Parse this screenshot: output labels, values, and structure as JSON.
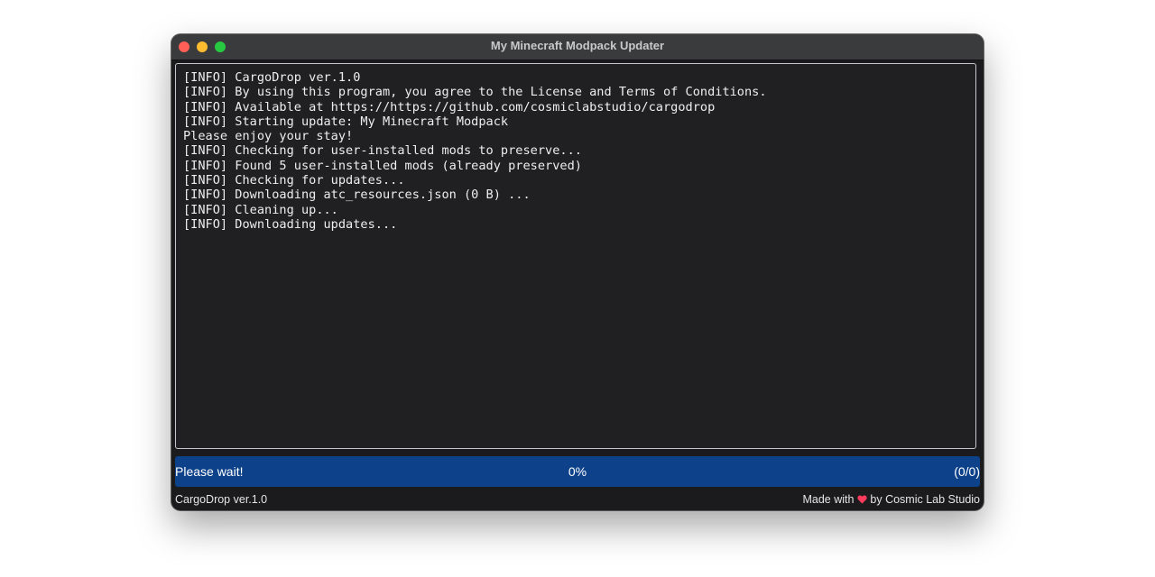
{
  "window": {
    "title": "My Minecraft Modpack Updater"
  },
  "traffic_lights": {
    "close_color": "#ff5f57",
    "minimize_color": "#febc2e",
    "zoom_color": "#28c840"
  },
  "log": {
    "lines": [
      "[INFO] CargoDrop ver.1.0",
      "[INFO] By using this program, you agree to the License and Terms of Conditions.",
      "[INFO] Available at https://https://github.com/cosmiclabstudio/cargodrop",
      "[INFO] Starting update: My Minecraft Modpack",
      "Please enjoy your stay!",
      "[INFO] Checking for user-installed mods to preserve...",
      "[INFO] Found 5 user-installed mods (already preserved)",
      "[INFO] Checking for updates...",
      "[INFO] Downloading atc_resources.json (0 B) ...",
      "[INFO] Cleaning up...",
      "[INFO] Downloading updates..."
    ]
  },
  "progress": {
    "status": "Please wait!",
    "percent_label": "0%",
    "percent": 0,
    "count_label": "(0/0)",
    "bar_color": "#0d4189"
  },
  "footer": {
    "version": "CargoDrop ver.1.0",
    "made_with": "Made with",
    "by_label": "by Cosmic Lab Studio",
    "heart_color": "#ff3b5c"
  }
}
